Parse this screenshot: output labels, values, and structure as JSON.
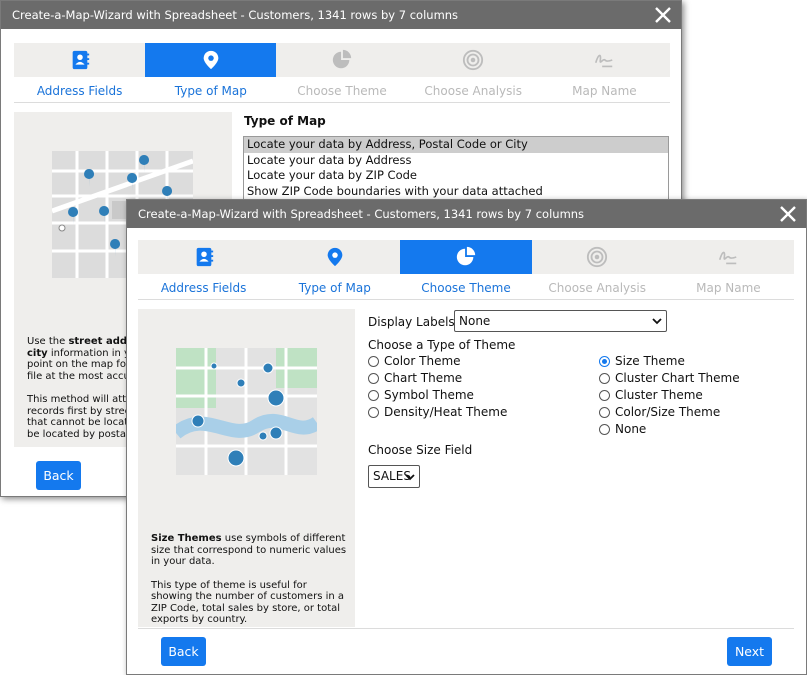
{
  "back_dialog": {
    "title": "Create-a-Map-Wizard with Spreadsheet - Customers, 1341 rows by 7 columns",
    "steps": [
      {
        "label": "Address Fields",
        "state": "done"
      },
      {
        "label": "Type of Map",
        "state": "active"
      },
      {
        "label": "Choose Theme",
        "state": "disabled"
      },
      {
        "label": "Choose Analysis",
        "state": "disabled"
      },
      {
        "label": "Map Name",
        "state": "disabled"
      }
    ],
    "type_of_map_heading": "Type of Map",
    "map_types": [
      "Locate your data by Address, Postal Code or City",
      "Locate your data by Address",
      "Locate your data by ZIP Code",
      "Show ZIP Code boundaries with your data attached"
    ],
    "selected_map_type": "Locate your data by Address, Postal Code or City",
    "side_help": {
      "p1_pre": "Use the ",
      "p1_bold": "street address",
      "p1_line2_bold": "city",
      "p1_line2": " information in your",
      "p1_line3": "point on the map for ea",
      "p1_line4": "file at the most accurat",
      "p2_line1": "This method will attem",
      "p2_line2": "records first by street a",
      "p2_line3": "that cannot be located",
      "p2_line4": "be located by postal co"
    },
    "back_label": "Back"
  },
  "front_dialog": {
    "title": "Create-a-Map-Wizard with Spreadsheet - Customers, 1341 rows by 7 columns",
    "steps": [
      {
        "label": "Address Fields",
        "state": "done"
      },
      {
        "label": "Type of Map",
        "state": "done"
      },
      {
        "label": "Choose Theme",
        "state": "active"
      },
      {
        "label": "Choose Analysis",
        "state": "disabled"
      },
      {
        "label": "Map Name",
        "state": "disabled"
      }
    ],
    "display_labels": {
      "label": "Display Labels",
      "value": "None"
    },
    "theme_heading": "Choose a Type of Theme",
    "themes_left": [
      "Color Theme",
      "Chart Theme",
      "Symbol Theme",
      "Density/Heat Theme"
    ],
    "themes_right": [
      "Size Theme",
      "Cluster Chart Theme",
      "Cluster Theme",
      "Color/Size Theme",
      "None"
    ],
    "selected_theme": "Size Theme",
    "size_field": {
      "heading": "Choose Size Field",
      "value": "SALES"
    },
    "side_help": {
      "bold": "Size Themes",
      "p1_rest": " use symbols of different size that correspond to numeric values in your data.",
      "p2": "This type of theme is useful for showing the number of customers in a ZIP Code, total sales by store, or total exports by country."
    },
    "back_label": "Back",
    "next_label": "Next"
  },
  "colors": {
    "accent": "#1479ee",
    "titlebar": "#6b6b6b",
    "panel": "#efeeec"
  }
}
